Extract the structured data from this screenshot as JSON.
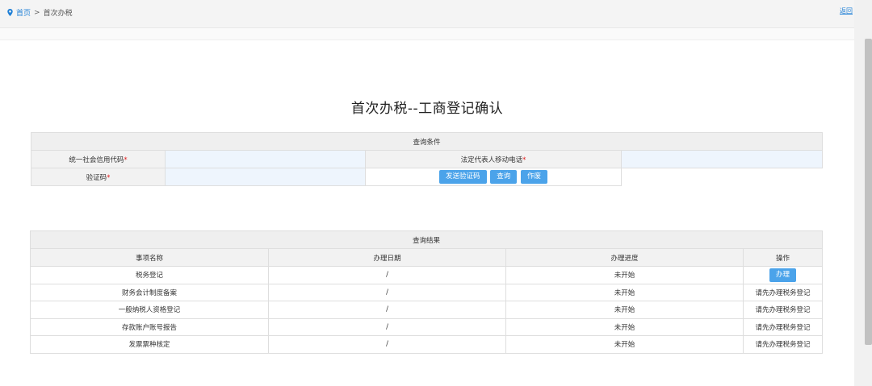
{
  "breadcrumb": {
    "home": "首页",
    "separator": ">",
    "current": "首次办税"
  },
  "back_link": "返回",
  "title": "首次办税--工商登记确认",
  "query": {
    "header": "查询条件",
    "credit_code_label": "统一社会信用代码",
    "phone_label": "法定代表人移动电话",
    "captcha_label": "验证码",
    "required_mark": "*",
    "credit_code_value": "",
    "phone_value": "",
    "captcha_value": "",
    "btn_send": "发送验证码",
    "btn_query": "查询",
    "btn_reset": "作废"
  },
  "results": {
    "header": "查询结果",
    "columns": [
      "事项名称",
      "办理日期",
      "办理进度",
      "操作"
    ],
    "rows": [
      {
        "name": "税务登记",
        "date": "/",
        "status": "未开始",
        "action": "办理"
      },
      {
        "name": "财务会计制度备案",
        "date": "/",
        "status": "未开始",
        "action": "请先办理税务登记"
      },
      {
        "name": "一般纳税人资格登记",
        "date": "/",
        "status": "未开始",
        "action": "请先办理税务登记"
      },
      {
        "name": "存款账户账号报告",
        "date": "/",
        "status": "未开始",
        "action": "请先办理税务登记"
      },
      {
        "name": "发票票种核定",
        "date": "/",
        "status": "未开始",
        "action": "请先办理税务登记"
      }
    ]
  },
  "colors": {
    "accent": "#4ba3ea",
    "link": "#1e7fd6",
    "required": "#e02020"
  }
}
